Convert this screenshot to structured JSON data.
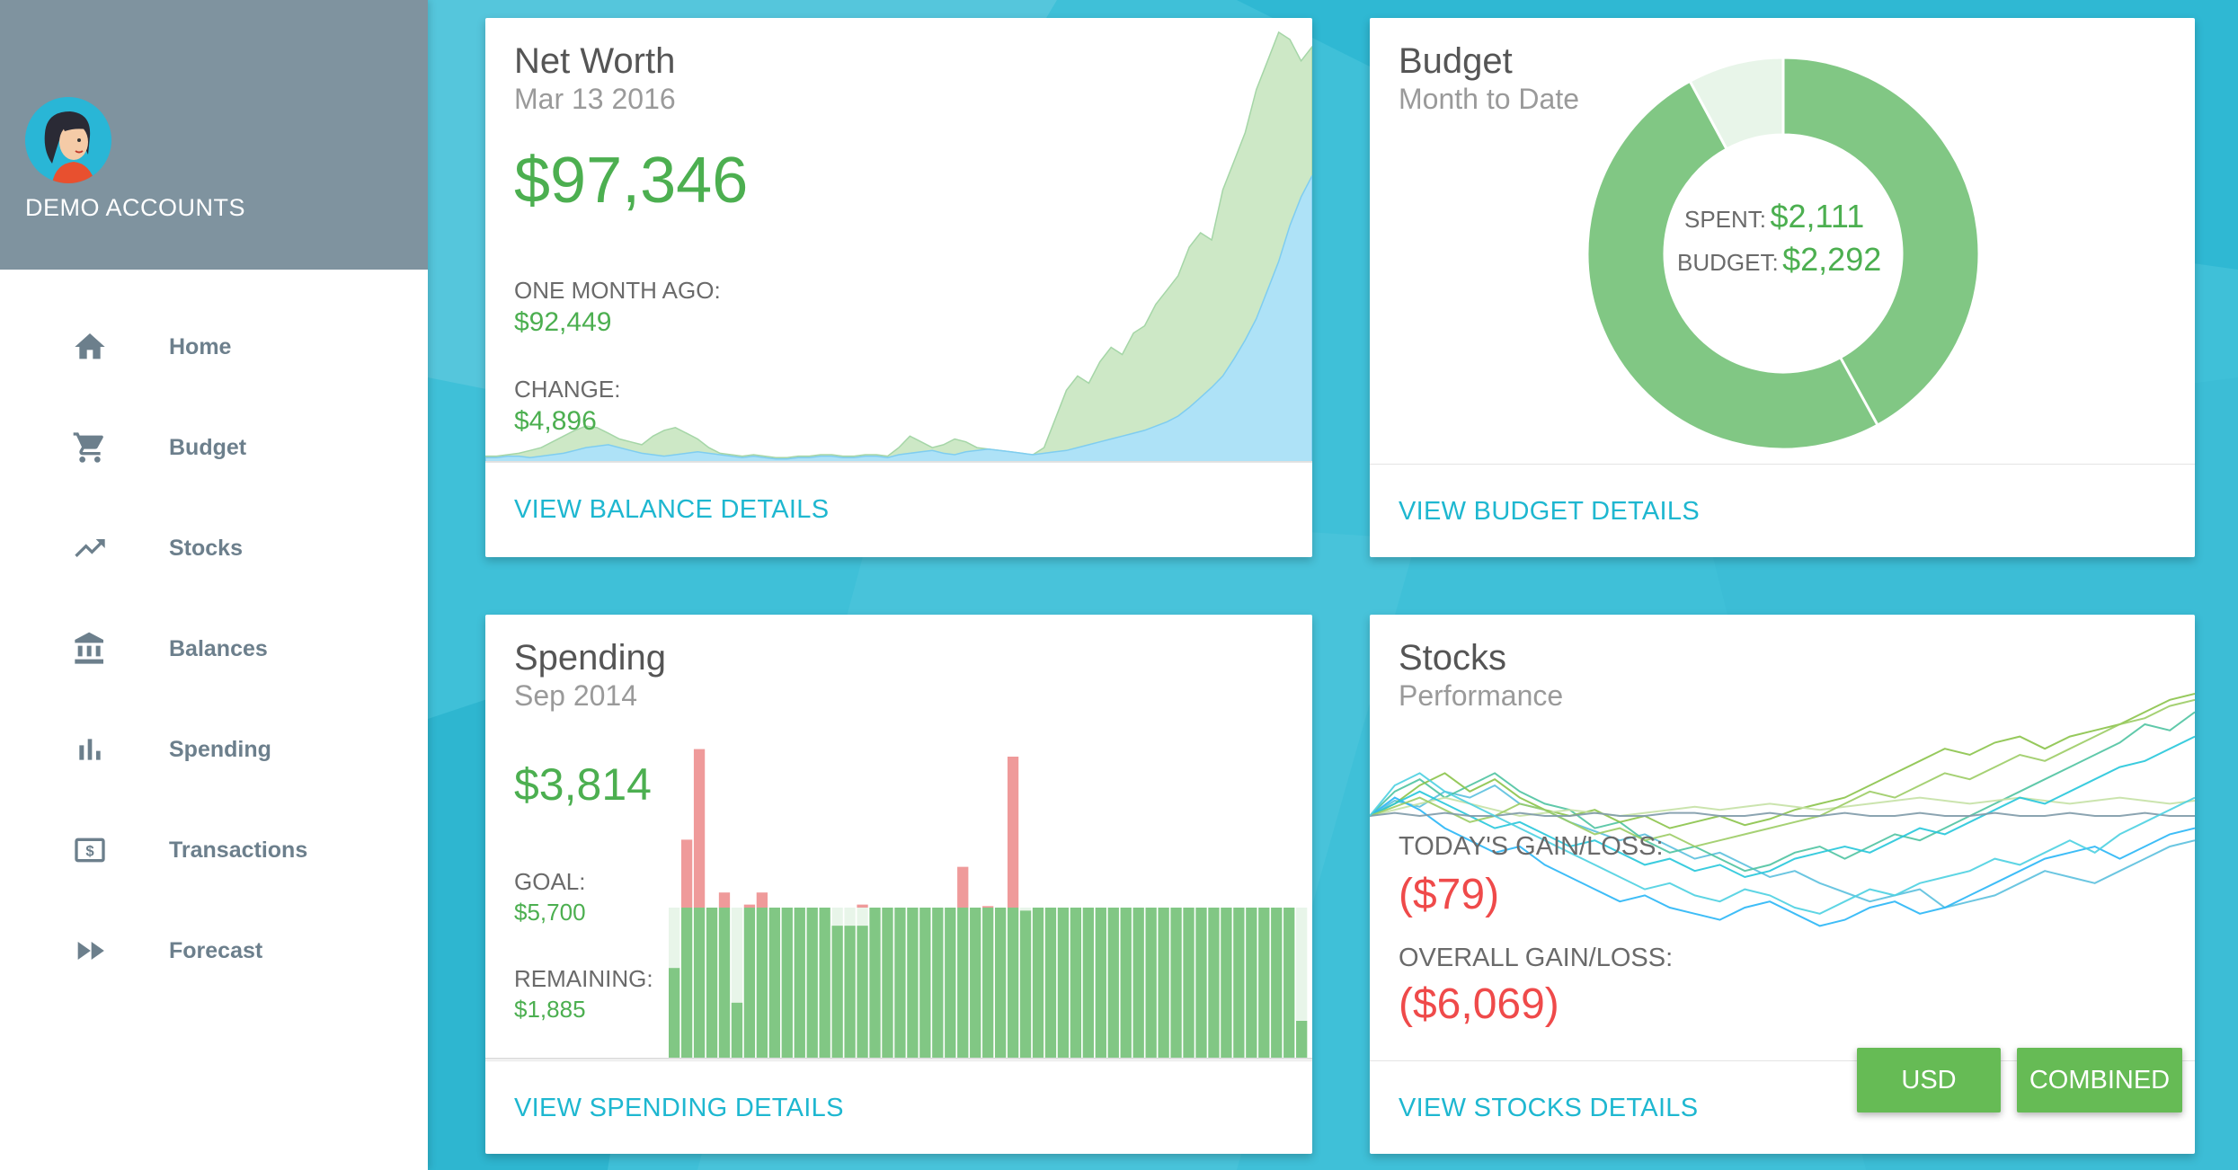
{
  "sidebar": {
    "account_label": "DEMO ACCOUNTS",
    "items": [
      {
        "label": "Home",
        "icon": "home-icon"
      },
      {
        "label": "Budget",
        "icon": "cart-icon"
      },
      {
        "label": "Stocks",
        "icon": "trending-up-icon"
      },
      {
        "label": "Balances",
        "icon": "bank-icon"
      },
      {
        "label": "Spending",
        "icon": "bar-chart-icon"
      },
      {
        "label": "Transactions",
        "icon": "dollar-bill-icon"
      },
      {
        "label": "Forecast",
        "icon": "fast-forward-icon"
      }
    ]
  },
  "net_worth": {
    "title": "Net Worth",
    "date": "Mar 13 2016",
    "value": "$97,346",
    "month_ago_label": "ONE MONTH AGO:",
    "month_ago_value": "$92,449",
    "change_label": "CHANGE:",
    "change_value": "$4,896",
    "link": "VIEW BALANCE DETAILS"
  },
  "budget": {
    "title": "Budget",
    "subtitle": "Month to Date",
    "spent_label": "SPENT:",
    "spent_value": "$2,111",
    "budget_label": "BUDGET:",
    "budget_value": "$2,292",
    "link": "VIEW BUDGET DETAILS"
  },
  "spending": {
    "title": "Spending",
    "date": "Sep 2014",
    "value": "$3,814",
    "goal_label": "GOAL:",
    "goal_value": "$5,700",
    "remaining_label": "REMAINING:",
    "remaining_value": "$1,885",
    "link": "VIEW SPENDING DETAILS"
  },
  "stocks": {
    "title": "Stocks",
    "subtitle": "Performance",
    "today_label": "TODAY'S GAIN/LOSS:",
    "today_value": "($79)",
    "overall_label": "OVERALL GAIN/LOSS:",
    "overall_value": "($6,069)",
    "link": "VIEW STOCKS DETAILS",
    "usd_button": "USD",
    "combined_button": "COMBINED"
  },
  "colors": {
    "green": "#4caf50",
    "red": "#ef4a4a",
    "link": "#1eb7d0",
    "sidebar_header": "#7f939f",
    "background": "#3fc0d8"
  },
  "chart_data": [
    {
      "type": "area",
      "series": [
        {
          "values": [
            3,
            3,
            4,
            4,
            3,
            4,
            5,
            6,
            8,
            10,
            11,
            12,
            10,
            8,
            6,
            5,
            4,
            5,
            6,
            7,
            6,
            5,
            4,
            3,
            4,
            3,
            2,
            2,
            3,
            3,
            4,
            4,
            3,
            3,
            4,
            4,
            3,
            5,
            6,
            7,
            8,
            6,
            5,
            7,
            8,
            9,
            8,
            7,
            6,
            5,
            6,
            7,
            8,
            10,
            12,
            14,
            16,
            18,
            20,
            22,
            25,
            28,
            32,
            38,
            45,
            52,
            60,
            72,
            85,
            100,
            120,
            140,
            165,
            185,
            200
          ]
        },
        {
          "values": [
            4,
            4,
            5,
            6,
            8,
            10,
            14,
            18,
            22,
            25,
            24,
            20,
            16,
            14,
            12,
            18,
            22,
            24,
            20,
            16,
            10,
            6,
            5,
            4,
            5,
            4,
            3,
            3,
            4,
            4,
            5,
            5,
            4,
            4,
            5,
            5,
            4,
            10,
            18,
            14,
            10,
            12,
            16,
            14,
            10,
            9,
            8,
            7,
            6,
            5,
            10,
            30,
            50,
            60,
            55,
            70,
            80,
            75,
            90,
            95,
            110,
            120,
            130,
            150,
            160,
            155,
            190,
            210,
            230,
            260,
            280,
            300,
            295,
            280,
            290
          ]
        }
      ],
      "ylim": [
        0,
        310
      ]
    },
    {
      "type": "pie",
      "values": [
        2111,
        181
      ],
      "categories": [
        "Spent",
        "Remaining"
      ]
    },
    {
      "type": "bar",
      "goal": 100,
      "values": [
        60,
        100,
        100,
        100,
        100,
        37,
        100,
        100,
        100,
        100,
        100,
        100,
        100,
        88,
        88,
        88,
        100,
        100,
        100,
        100,
        100,
        100,
        100,
        100,
        100,
        100,
        100,
        100,
        98,
        100,
        100,
        100,
        100,
        100,
        100,
        100,
        100,
        100,
        100,
        100,
        100,
        100,
        100,
        100,
        100,
        100,
        100,
        100,
        100,
        100,
        25
      ],
      "overs": [
        0,
        45,
        105,
        0,
        10,
        0,
        2,
        10,
        0,
        0,
        0,
        0,
        0,
        0,
        0,
        2,
        0,
        0,
        0,
        0,
        0,
        0,
        0,
        27,
        0,
        1,
        0,
        100,
        0,
        0,
        0,
        0,
        0,
        0,
        0,
        0,
        0,
        0,
        0,
        0,
        0,
        0,
        0,
        0,
        0,
        0,
        0,
        0,
        0,
        0,
        0
      ]
    },
    {
      "type": "line",
      "series": [
        {
          "color": "#5bc0de",
          "values": [
            0,
            5,
            3,
            8,
            6,
            10,
            4,
            2,
            -2,
            -5,
            -8,
            -6,
            -10,
            -14,
            -12,
            -16,
            -20,
            -18,
            -22,
            -25,
            -28,
            -26,
            -24,
            -30,
            -28,
            -26,
            -22,
            -18,
            -20,
            -22,
            -18,
            -14,
            -10,
            -8
          ]
        },
        {
          "color": "#4fc3a1",
          "values": [
            0,
            8,
            12,
            6,
            10,
            14,
            8,
            4,
            2,
            -4,
            -2,
            -8,
            -12,
            -10,
            -14,
            -18,
            -16,
            -12,
            -10,
            -14,
            -10,
            -6,
            -8,
            -4,
            0,
            4,
            8,
            12,
            16,
            20,
            24,
            30,
            28,
            34
          ]
        },
        {
          "color": "#8bc34a",
          "values": [
            0,
            4,
            10,
            14,
            8,
            12,
            6,
            2,
            0,
            2,
            -2,
            0,
            -4,
            -2,
            0,
            -3,
            -1,
            2,
            4,
            6,
            10,
            14,
            18,
            22,
            20,
            24,
            26,
            22,
            26,
            28,
            30,
            34,
            38,
            40
          ]
        },
        {
          "color": "#c5e1a5",
          "values": [
            0,
            2,
            4,
            6,
            4,
            2,
            0,
            1,
            2,
            1,
            0,
            1,
            2,
            3,
            2,
            3,
            4,
            3,
            2,
            3,
            4,
            5,
            6,
            5,
            4,
            5,
            6,
            5,
            4,
            5,
            6,
            5,
            4,
            5
          ]
        },
        {
          "color": "#29b6f6",
          "values": [
            0,
            6,
            2,
            -4,
            -8,
            -12,
            -10,
            -16,
            -20,
            -24,
            -28,
            -26,
            -30,
            -32,
            -34,
            -30,
            -28,
            -32,
            -36,
            -34,
            -30,
            -28,
            -32,
            -30,
            -26,
            -22,
            -18,
            -14,
            -12,
            -10,
            -14,
            -10,
            -6,
            -4
          ]
        },
        {
          "color": "#26c6da",
          "values": [
            0,
            4,
            8,
            4,
            0,
            -4,
            -2,
            -6,
            -10,
            -8,
            -12,
            -16,
            -14,
            -18,
            -16,
            -20,
            -18,
            -14,
            -12,
            -10,
            -12,
            -8,
            -4,
            -6,
            -2,
            2,
            6,
            4,
            8,
            12,
            16,
            18,
            22,
            26
          ]
        },
        {
          "color": "#9ccc65",
          "values": [
            0,
            3,
            6,
            2,
            -2,
            0,
            4,
            2,
            -2,
            -6,
            -4,
            -8,
            -6,
            -10,
            -8,
            -6,
            -4,
            -2,
            0,
            4,
            8,
            6,
            10,
            14,
            12,
            16,
            20,
            18,
            22,
            26,
            30,
            32,
            36,
            38
          ]
        },
        {
          "color": "#7e9aa8",
          "values": [
            0,
            1,
            0,
            1,
            0,
            0,
            1,
            0,
            0,
            1,
            0,
            0,
            1,
            1,
            0,
            0,
            1,
            0,
            0,
            1,
            0,
            0,
            1,
            0,
            0,
            1,
            0,
            0,
            1,
            0,
            0,
            1,
            0,
            0
          ]
        },
        {
          "color": "#4dd0e1",
          "values": [
            0,
            10,
            14,
            8,
            4,
            0,
            -4,
            -8,
            -12,
            -16,
            -20,
            -24,
            -22,
            -26,
            -28,
            -24,
            -26,
            -30,
            -32,
            -28,
            -24,
            -26,
            -22,
            -20,
            -18,
            -14,
            -16,
            -12,
            -8,
            -12,
            -6,
            -2,
            2,
            6
          ]
        }
      ]
    }
  ]
}
